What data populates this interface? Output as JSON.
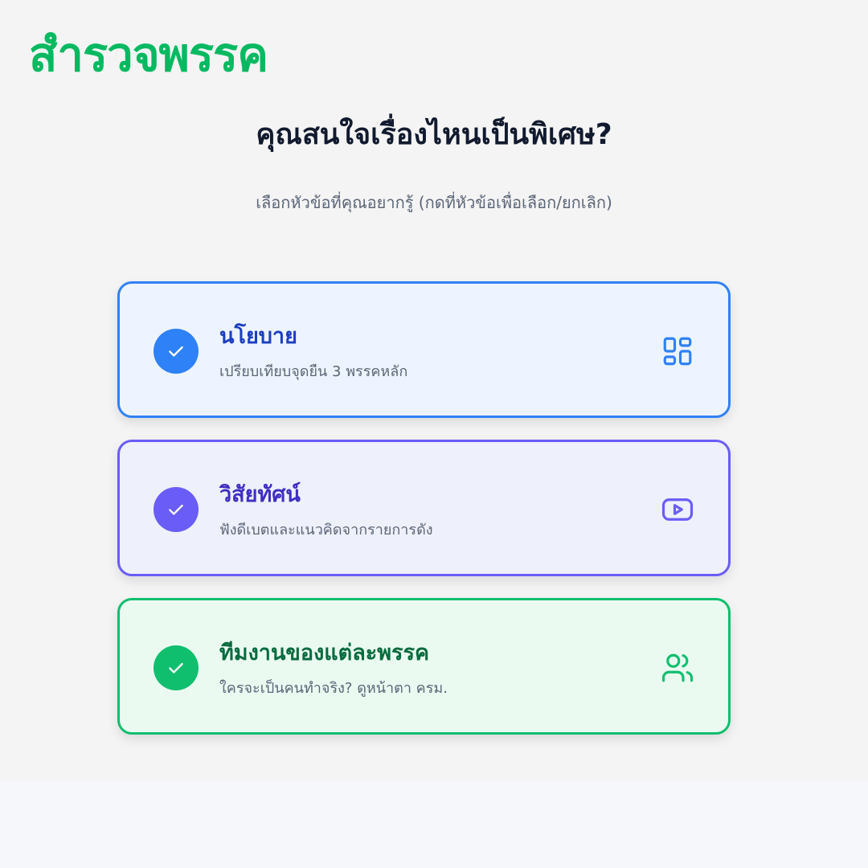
{
  "logo": "สำรวจพรรค",
  "headline": "คุณสนใจเรื่องไหนเป็นพิเศษ?",
  "subtitle": "เลือกหัวข้อที่คุณอยากรู้ (กดที่หัวข้อเพื่อเลือก/ยกเลิก)",
  "topics": [
    {
      "title": "นโยบาย",
      "description": "เปรียบเทียบจุดยืน 3 พรรคหลัก",
      "selected": true,
      "icon": "dashboard-grid-icon",
      "accent": "#2f81f7",
      "background": "#eef4ff",
      "title_color": "#1d3fbf"
    },
    {
      "title": "วิสัยทัศน์",
      "description": "ฟังดีเบตและแนวคิดจากรายการดัง",
      "selected": true,
      "icon": "video-play-icon",
      "accent": "#6a5cf6",
      "background": "#eef0fc",
      "title_color": "#3f2ec2"
    },
    {
      "title": "ทีมงานของแต่ละพรรค",
      "description": "ใครจะเป็นคนทำจริง? ดูหน้าตา ครม.",
      "selected": true,
      "icon": "users-icon",
      "accent": "#10bf6e",
      "background": "#eafaf1",
      "title_color": "#066b3e"
    }
  ]
}
